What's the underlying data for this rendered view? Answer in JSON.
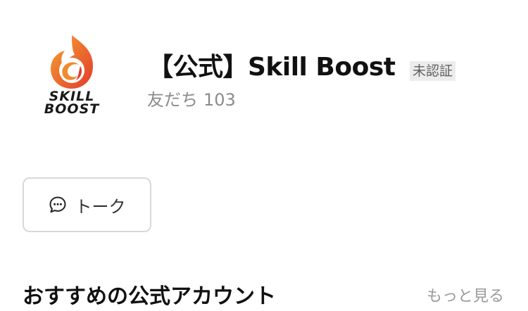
{
  "profile": {
    "name": "【公式】Skill Boost",
    "verification": "未認証",
    "friends_label": "友だち",
    "friends_count": "103",
    "logo": {
      "icon": "skill-boost-flame-logo",
      "text_line1": "SKILL",
      "text_line2": "BOOST",
      "colors": {
        "flame_outer": "#e8402c",
        "flame_inner": "#f39a2b",
        "text": "#1a1a1a"
      }
    }
  },
  "actions": {
    "talk": {
      "label": "トーク",
      "icon": "chat-bubble-icon"
    }
  },
  "recommended": {
    "title": "おすすめの公式アカウント",
    "more_label": "もっと見る"
  }
}
